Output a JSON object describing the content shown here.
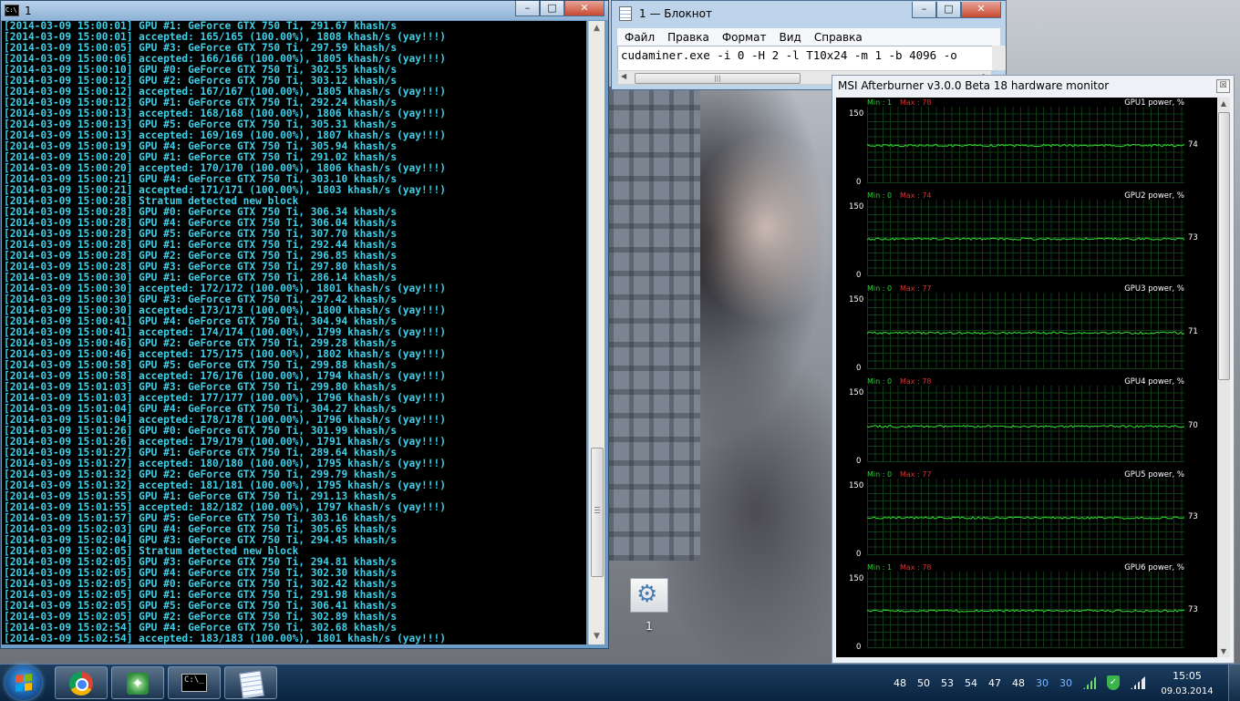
{
  "console": {
    "title": "1",
    "lines": [
      "[2014-03-09 15:00:01] GPU #1: GeForce GTX 750 Ti, 291.67 khash/s",
      "[2014-03-09 15:00:01] accepted: 165/165 (100.00%), 1808 khash/s (yay!!!)",
      "[2014-03-09 15:00:05] GPU #3: GeForce GTX 750 Ti, 297.59 khash/s",
      "[2014-03-09 15:00:06] accepted: 166/166 (100.00%), 1805 khash/s (yay!!!)",
      "[2014-03-09 15:00:10] GPU #0: GeForce GTX 750 Ti, 302.55 khash/s",
      "[2014-03-09 15:00:12] GPU #2: GeForce GTX 750 Ti, 303.12 khash/s",
      "[2014-03-09 15:00:12] accepted: 167/167 (100.00%), 1805 khash/s (yay!!!)",
      "[2014-03-09 15:00:12] GPU #1: GeForce GTX 750 Ti, 292.24 khash/s",
      "[2014-03-09 15:00:13] accepted: 168/168 (100.00%), 1806 khash/s (yay!!!)",
      "[2014-03-09 15:00:13] GPU #5: GeForce GTX 750 Ti, 305.31 khash/s",
      "[2014-03-09 15:00:13] accepted: 169/169 (100.00%), 1807 khash/s (yay!!!)",
      "[2014-03-09 15:00:19] GPU #4: GeForce GTX 750 Ti, 305.94 khash/s",
      "[2014-03-09 15:00:20] GPU #1: GeForce GTX 750 Ti, 291.02 khash/s",
      "[2014-03-09 15:00:20] accepted: 170/170 (100.00%), 1806 khash/s (yay!!!)",
      "[2014-03-09 15:00:21] GPU #4: GeForce GTX 750 Ti, 303.10 khash/s",
      "[2014-03-09 15:00:21] accepted: 171/171 (100.00%), 1803 khash/s (yay!!!)",
      "[2014-03-09 15:00:28] Stratum detected new block",
      "[2014-03-09 15:00:28] GPU #0: GeForce GTX 750 Ti, 306.34 khash/s",
      "[2014-03-09 15:00:28] GPU #4: GeForce GTX 750 Ti, 306.04 khash/s",
      "[2014-03-09 15:00:28] GPU #5: GeForce GTX 750 Ti, 307.70 khash/s",
      "[2014-03-09 15:00:28] GPU #1: GeForce GTX 750 Ti, 292.44 khash/s",
      "[2014-03-09 15:00:28] GPU #2: GeForce GTX 750 Ti, 296.85 khash/s",
      "[2014-03-09 15:00:28] GPU #3: GeForce GTX 750 Ti, 297.80 khash/s",
      "[2014-03-09 15:00:30] GPU #1: GeForce GTX 750 Ti, 286.14 khash/s",
      "[2014-03-09 15:00:30] accepted: 172/172 (100.00%), 1801 khash/s (yay!!!)",
      "[2014-03-09 15:00:30] GPU #3: GeForce GTX 750 Ti, 297.42 khash/s",
      "[2014-03-09 15:00:30] accepted: 173/173 (100.00%), 1800 khash/s (yay!!!)",
      "[2014-03-09 15:00:41] GPU #4: GeForce GTX 750 Ti, 304.94 khash/s",
      "[2014-03-09 15:00:41] accepted: 174/174 (100.00%), 1799 khash/s (yay!!!)",
      "[2014-03-09 15:00:46] GPU #2: GeForce GTX 750 Ti, 299.28 khash/s",
      "[2014-03-09 15:00:46] accepted: 175/175 (100.00%), 1802 khash/s (yay!!!)",
      "[2014-03-09 15:00:58] GPU #5: GeForce GTX 750 Ti, 299.88 khash/s",
      "[2014-03-09 15:00:58] accepted: 176/176 (100.00%), 1794 khash/s (yay!!!)",
      "[2014-03-09 15:01:03] GPU #3: GeForce GTX 750 Ti, 299.80 khash/s",
      "[2014-03-09 15:01:03] accepted: 177/177 (100.00%), 1796 khash/s (yay!!!)",
      "[2014-03-09 15:01:04] GPU #4: GeForce GTX 750 Ti, 304.27 khash/s",
      "[2014-03-09 15:01:04] accepted: 178/178 (100.00%), 1796 khash/s (yay!!!)",
      "[2014-03-09 15:01:26] GPU #0: GeForce GTX 750 Ti, 301.99 khash/s",
      "[2014-03-09 15:01:26] accepted: 179/179 (100.00%), 1791 khash/s (yay!!!)",
      "[2014-03-09 15:01:27] GPU #1: GeForce GTX 750 Ti, 289.64 khash/s",
      "[2014-03-09 15:01:27] accepted: 180/180 (100.00%), 1795 khash/s (yay!!!)",
      "[2014-03-09 15:01:32] GPU #2: GeForce GTX 750 Ti, 299.79 khash/s",
      "[2014-03-09 15:01:32] accepted: 181/181 (100.00%), 1795 khash/s (yay!!!)",
      "[2014-03-09 15:01:55] GPU #1: GeForce GTX 750 Ti, 291.13 khash/s",
      "[2014-03-09 15:01:55] accepted: 182/182 (100.00%), 1797 khash/s (yay!!!)",
      "[2014-03-09 15:01:57] GPU #5: GeForce GTX 750 Ti, 303.16 khash/s",
      "[2014-03-09 15:02:03] GPU #4: GeForce GTX 750 Ti, 305.65 khash/s",
      "[2014-03-09 15:02:04] GPU #3: GeForce GTX 750 Ti, 294.45 khash/s",
      "[2014-03-09 15:02:05] Stratum detected new block",
      "[2014-03-09 15:02:05] GPU #3: GeForce GTX 750 Ti, 294.81 khash/s",
      "[2014-03-09 15:02:05] GPU #4: GeForce GTX 750 Ti, 302.30 khash/s",
      "[2014-03-09 15:02:05] GPU #0: GeForce GTX 750 Ti, 302.42 khash/s",
      "[2014-03-09 15:02:05] GPU #1: GeForce GTX 750 Ti, 291.98 khash/s",
      "[2014-03-09 15:02:05] GPU #5: GeForce GTX 750 Ti, 306.41 khash/s",
      "[2014-03-09 15:02:05] GPU #2: GeForce GTX 750 Ti, 302.89 khash/s",
      "[2014-03-09 15:02:54] GPU #4: GeForce GTX 750 Ti, 302.68 khash/s",
      "[2014-03-09 15:02:54] accepted: 183/183 (100.00%), 1801 khash/s (yay!!!)"
    ]
  },
  "notepad": {
    "title": "1 — Блокнот",
    "menu": [
      "Файл",
      "Правка",
      "Формат",
      "Вид",
      "Справка"
    ],
    "content": "cudaminer.exe -i 0 -H 2 -l T10x24 -m 1 -b 4096 -o"
  },
  "afterburner": {
    "title": "MSI Afterburner v3.0.0 Beta 18 hardware monitor",
    "close_glyph": "☒",
    "axis_top": "150",
    "axis_bottom": "0",
    "line_color": "#35e335",
    "graphs": [
      {
        "name": "GPU1 power, %",
        "min": "Min : 1",
        "max": "Max : 78",
        "current": 74
      },
      {
        "name": "GPU2 power, %",
        "min": "Min : 0",
        "max": "Max : 74",
        "current": 73
      },
      {
        "name": "GPU3 power, %",
        "min": "Min : 0",
        "max": "Max : 77",
        "current": 71
      },
      {
        "name": "GPU4 power, %",
        "min": "Min : 0",
        "max": "Max : 78",
        "current": 70
      },
      {
        "name": "GPU5 power, %",
        "min": "Min : 0",
        "max": "Max : 77",
        "current": 73
      },
      {
        "name": "GPU6 power, %",
        "min": "Min : 1",
        "max": "Max : 78",
        "current": 73
      }
    ]
  },
  "desktop_icon": {
    "label": "1",
    "icon": "gear-icon"
  },
  "taskbar": {
    "tray_values": [
      {
        "value": "48",
        "color": "#ffffff"
      },
      {
        "value": "50",
        "color": "#ffffff"
      },
      {
        "value": "53",
        "color": "#ffffff"
      },
      {
        "value": "54",
        "color": "#ffffff"
      },
      {
        "value": "47",
        "color": "#ffffff"
      },
      {
        "value": "48",
        "color": "#ffffff"
      },
      {
        "value": "30",
        "color": "#7ab8ff"
      },
      {
        "value": "30",
        "color": "#7ab8ff"
      }
    ],
    "time": "15:05",
    "date": "09.03.2014"
  }
}
